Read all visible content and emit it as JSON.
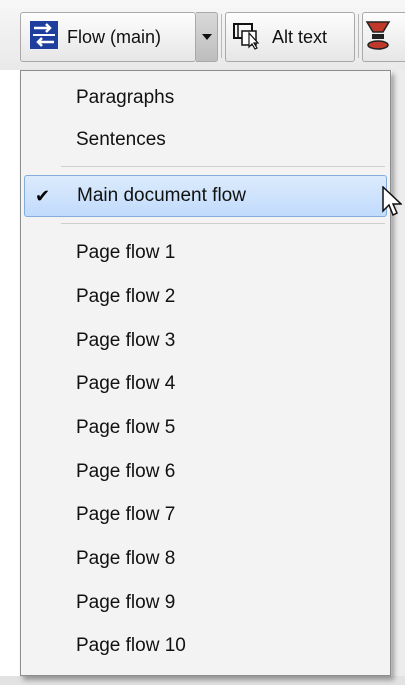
{
  "toolbar": {
    "flow_button_label": "Flow (main)",
    "alt_text_label": "Alt text",
    "icons": [
      "flow-icon",
      "dropdown-arrow-icon",
      "alt-text-icon",
      "tool-icon"
    ]
  },
  "menu": {
    "group1": [
      {
        "label": "Paragraphs"
      },
      {
        "label": "Sentences"
      }
    ],
    "group2": [
      {
        "label": "Main document flow",
        "checked": true,
        "highlighted": true
      }
    ],
    "group3": [
      {
        "label": "Page flow 1"
      },
      {
        "label": "Page flow 2"
      },
      {
        "label": "Page flow 3"
      },
      {
        "label": "Page flow 4"
      },
      {
        "label": "Page flow 5"
      },
      {
        "label": "Page flow 6"
      },
      {
        "label": "Page flow 7"
      },
      {
        "label": "Page flow 8"
      },
      {
        "label": "Page flow 9"
      },
      {
        "label": "Page flow 10"
      }
    ],
    "check_glyph": "✔"
  },
  "colors": {
    "highlight": "#c9e0fb",
    "highlight_border": "#84acdd",
    "menu_bg": "#f3f3f3"
  }
}
